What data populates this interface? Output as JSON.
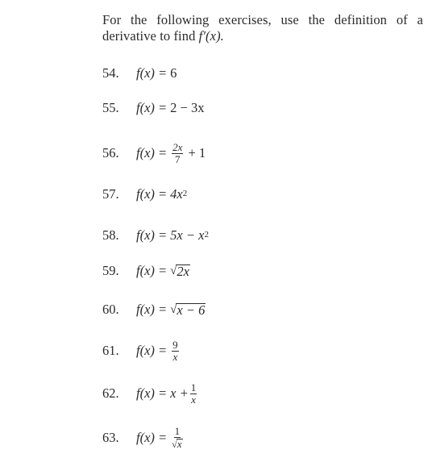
{
  "intro": {
    "line1": "For the following exercises, use the definition of a",
    "line2_prefix": "derivative to find ",
    "line2_math": "f′(x).",
    "full_text": "For the following exercises, use the definition of a derivative to find f′(x)."
  },
  "exercises": [
    {
      "number": "54.",
      "lhs": "f(x) =",
      "rhs": "6",
      "text": "f(x) = 6"
    },
    {
      "number": "55.",
      "lhs": "f(x) =",
      "rhs": "2 − 3x",
      "text": "f(x) = 2 − 3x"
    },
    {
      "number": "56.",
      "lhs": "f(x) =",
      "frac_num": "2x",
      "frac_den": "7",
      "tail": "+ 1",
      "text": "f(x) = 2x/7 + 1"
    },
    {
      "number": "57.",
      "lhs": "f(x) =",
      "base": "4x",
      "exp": "2",
      "text": "f(x) = 4x^2"
    },
    {
      "number": "58.",
      "lhs": "f(x) =",
      "base": "5x − x",
      "exp": "2",
      "text": "f(x) = 5x − x^2"
    },
    {
      "number": "59.",
      "lhs": "f(x) =",
      "radicand": "2x",
      "text": "f(x) = √(2x)"
    },
    {
      "number": "60.",
      "lhs": "f(x) =",
      "radicand": "x − 6",
      "text": "f(x) = √(x − 6)"
    },
    {
      "number": "61.",
      "lhs": "f(x) =",
      "frac_num": "9",
      "frac_den": "x",
      "text": "f(x) = 9/x"
    },
    {
      "number": "62.",
      "lhs": "f(x) =",
      "head": "x +",
      "frac_num": "1",
      "frac_den": "x",
      "text": "f(x) = x + 1/x"
    },
    {
      "number": "63.",
      "lhs": "f(x) =",
      "frac_num": "1",
      "frac_den_radicand": "x",
      "text": "f(x) = 1/√x"
    }
  ]
}
